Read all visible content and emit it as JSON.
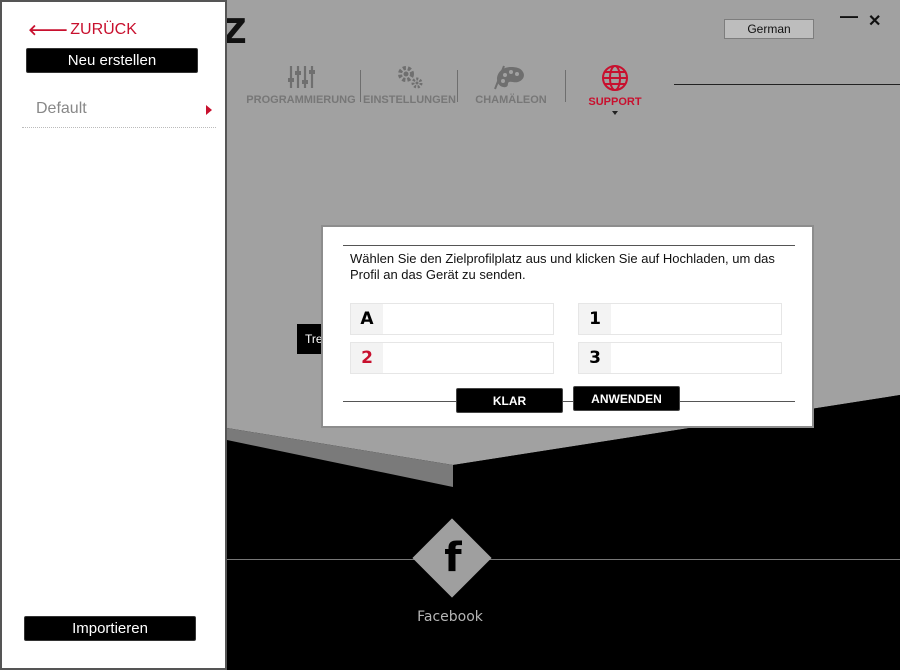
{
  "window": {
    "language": "German",
    "minimize_glyph": "—",
    "close_glyph": "✕",
    "logo_fragment": "Z"
  },
  "nav": {
    "items": [
      {
        "label": "PROGRAMMIERUNG",
        "icon": "sliders-icon"
      },
      {
        "label": "EINSTELLUNGEN",
        "icon": "gears-icon"
      },
      {
        "label": "CHAMÄLEON",
        "icon": "palette-icon"
      },
      {
        "label": "SUPPORT",
        "icon": "globe-icon"
      }
    ]
  },
  "background": {
    "button_fragment": "Tre",
    "social_label": "Facebook",
    "social_glyph": "f"
  },
  "sidebar": {
    "back_label": "ZURÜCK",
    "new_button": "Neu erstellen",
    "profiles": [
      {
        "name": "Default"
      }
    ],
    "import_button": "Importieren"
  },
  "dialog": {
    "message": "Wählen Sie den Zielprofilplatz aus und klicken Sie auf Hochladen, um das Profil an das Gerät zu senden.",
    "slots": [
      {
        "label": "A",
        "value": "",
        "active": false
      },
      {
        "label": "1",
        "value": "",
        "active": false
      },
      {
        "label": "2",
        "value": "",
        "active": true
      },
      {
        "label": "3",
        "value": "",
        "active": false
      }
    ],
    "clear_button": "KLAR",
    "apply_button": "ANWENDEN"
  },
  "colors": {
    "accent": "#c8102e",
    "background_gray": "#a1a1a1",
    "panel_white": "#ffffff",
    "black": "#000000"
  }
}
